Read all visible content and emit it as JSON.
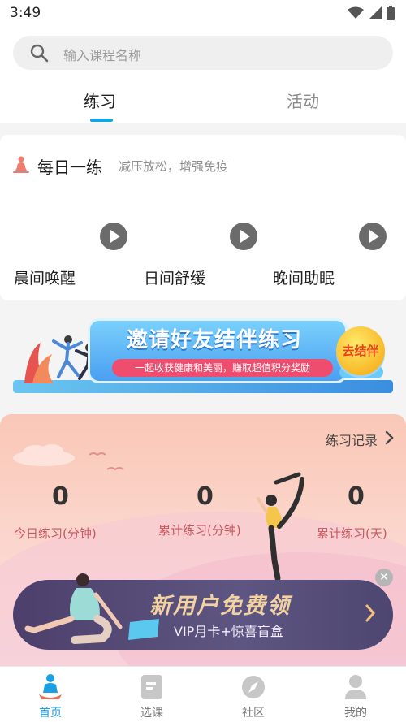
{
  "status_bar": {
    "time": "3:49"
  },
  "search": {
    "placeholder": "输入课程名称"
  },
  "tabs": [
    {
      "label": "练习",
      "active": true
    },
    {
      "label": "活动",
      "active": false
    }
  ],
  "daily_practice": {
    "title": "每日一练",
    "subtitle": "减压放松，增强免疫",
    "sessions": [
      {
        "label": "晨间唤醒"
      },
      {
        "label": "日间舒缓"
      },
      {
        "label": "晚间助眠"
      }
    ]
  },
  "invite_banner": {
    "title": "邀请好友结伴练习",
    "subtitle": "一起收获健康和美丽，赚取超值积分奖励",
    "button_label": "去结伴"
  },
  "stats": {
    "record_link": "练习记录",
    "items": [
      {
        "value": "0",
        "label": "今日练习(分钟)"
      },
      {
        "value": "0",
        "label": "累计练习(分钟)"
      },
      {
        "value": "0",
        "label": "累计练习(天)"
      }
    ]
  },
  "new_user_banner": {
    "title": "新用户免费领",
    "subtitle": "VIP月卡+惊喜盲盒"
  },
  "bottom_nav": [
    {
      "label": "首页",
      "active": true,
      "icon": "home-icon"
    },
    {
      "label": "选课",
      "active": false,
      "icon": "course-icon"
    },
    {
      "label": "社区",
      "active": false,
      "icon": "community-icon"
    },
    {
      "label": "我的",
      "active": false,
      "icon": "profile-icon"
    }
  ],
  "colors": {
    "accent": "#12a5e4",
    "stat_label": "#c8585f",
    "play": "#6b6b6b"
  }
}
